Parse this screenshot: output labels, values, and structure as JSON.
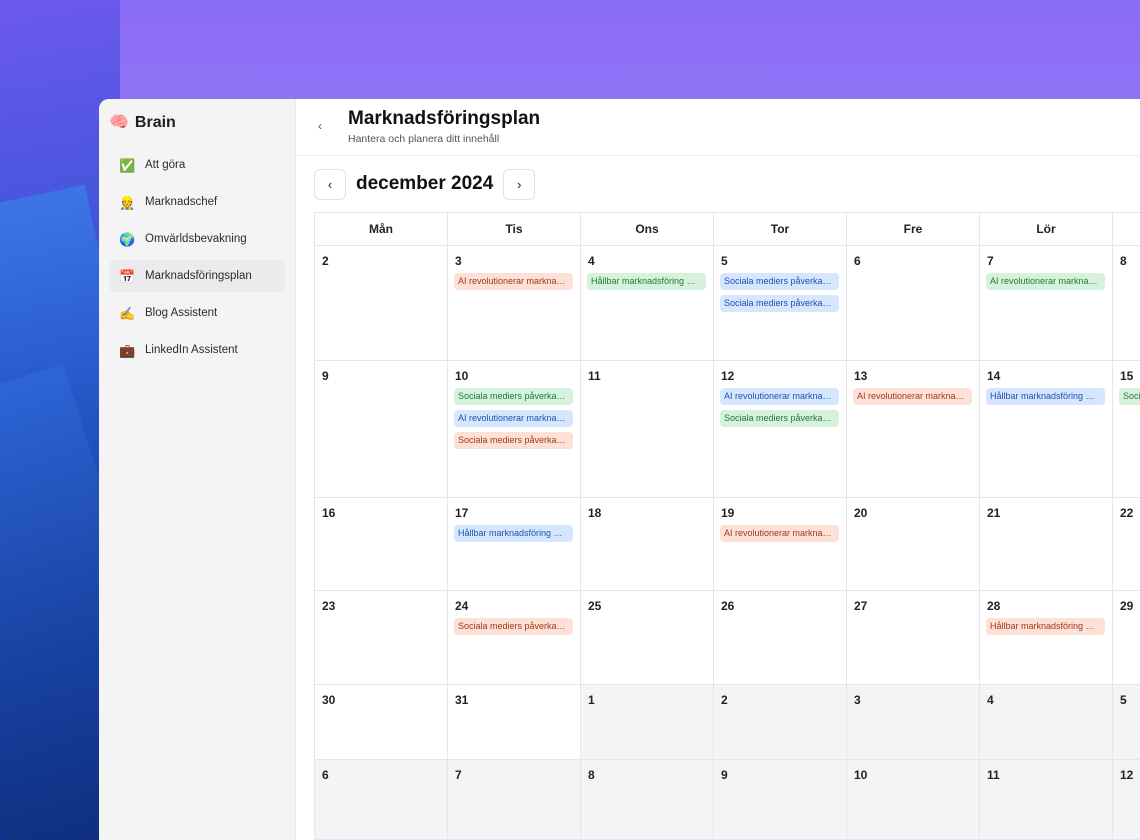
{
  "app": {
    "name": "Brain",
    "icon": "🧠"
  },
  "sidebar": {
    "items": [
      {
        "label": "Att göra",
        "icon": "✅",
        "icon_name": "checkmark-icon",
        "active": false
      },
      {
        "label": "Marknadschef",
        "icon": "👷",
        "icon_name": "worker-icon",
        "active": false
      },
      {
        "label": "Omvärldsbevakning",
        "icon": "🌍",
        "icon_name": "globe-icon",
        "active": false
      },
      {
        "label": "Marknadsföringsplan",
        "icon": "📅",
        "icon_name": "calendar-icon",
        "active": true
      },
      {
        "label": "Blog Assistent",
        "icon": "✍️",
        "icon_name": "writing-hand-icon",
        "active": false
      },
      {
        "label": "LinkedIn Assistent",
        "icon": "💼",
        "icon_name": "briefcase-icon",
        "active": false
      }
    ]
  },
  "header": {
    "back": "‹",
    "title": "Marknadsföringsplan",
    "subtitle": "Hantera och planera ditt innehåll"
  },
  "month_nav": {
    "prev": "‹",
    "next": "›",
    "label": "december 2024"
  },
  "colors": {
    "red_bg": "#fde0d6",
    "green_bg": "#d7f2dc",
    "blue_bg": "#d6e6fd"
  },
  "calendar": {
    "weekdays": [
      "Mån",
      "Tis",
      "Ons",
      "Tor",
      "Fre",
      "Lör",
      ""
    ],
    "weeks": [
      {
        "days": [
          {
            "day": "2",
            "events": []
          },
          {
            "day": "3",
            "events": [
              {
                "text": "AI revolutionerar markna…",
                "color": "red"
              }
            ]
          },
          {
            "day": "4",
            "events": [
              {
                "text": "Hållbar marknadsföring …",
                "color": "green"
              }
            ]
          },
          {
            "day": "5",
            "events": [
              {
                "text": "Sociala mediers påverka…",
                "color": "blue"
              },
              {
                "text": "Sociala mediers påverka…",
                "color": "blue"
              }
            ]
          },
          {
            "day": "6",
            "events": []
          },
          {
            "day": "7",
            "events": [
              {
                "text": "AI revolutionerar markna…",
                "color": "green"
              }
            ]
          },
          {
            "day": "8",
            "events": []
          }
        ]
      },
      {
        "days": [
          {
            "day": "9",
            "events": []
          },
          {
            "day": "10",
            "events": [
              {
                "text": "Sociala mediers påverka…",
                "color": "green"
              },
              {
                "text": "AI revolutionerar markna…",
                "color": "blue"
              },
              {
                "text": "Sociala mediers påverka…",
                "color": "red"
              }
            ]
          },
          {
            "day": "11",
            "events": []
          },
          {
            "day": "12",
            "events": [
              {
                "text": "AI revolutionerar markna…",
                "color": "blue"
              },
              {
                "text": "Sociala mediers påverka…",
                "color": "green"
              }
            ]
          },
          {
            "day": "13",
            "events": [
              {
                "text": "AI revolutionerar markna…",
                "color": "red"
              }
            ]
          },
          {
            "day": "14",
            "events": [
              {
                "text": "Hållbar marknadsföring …",
                "color": "blue"
              }
            ]
          },
          {
            "day": "15",
            "events": [
              {
                "text": "Sociala mediers påverka…",
                "color": "green"
              }
            ]
          }
        ]
      },
      {
        "days": [
          {
            "day": "16",
            "events": []
          },
          {
            "day": "17",
            "events": [
              {
                "text": "Hållbar marknadsföring …",
                "color": "blue"
              }
            ]
          },
          {
            "day": "18",
            "events": []
          },
          {
            "day": "19",
            "events": [
              {
                "text": "AI revolutionerar markna…",
                "color": "red"
              }
            ]
          },
          {
            "day": "20",
            "events": []
          },
          {
            "day": "21",
            "events": []
          },
          {
            "day": "22",
            "events": []
          }
        ]
      },
      {
        "days": [
          {
            "day": "23",
            "events": []
          },
          {
            "day": "24",
            "events": [
              {
                "text": "Sociala mediers påverka…",
                "color": "red"
              }
            ]
          },
          {
            "day": "25",
            "events": []
          },
          {
            "day": "26",
            "events": []
          },
          {
            "day": "27",
            "events": []
          },
          {
            "day": "28",
            "events": [
              {
                "text": "Hållbar marknadsföring …",
                "color": "red"
              }
            ]
          },
          {
            "day": "29",
            "events": []
          }
        ]
      },
      {
        "days": [
          {
            "day": "30",
            "events": []
          },
          {
            "day": "31",
            "events": []
          },
          {
            "day": "1",
            "other": true,
            "events": []
          },
          {
            "day": "2",
            "other": true,
            "events": []
          },
          {
            "day": "3",
            "other": true,
            "events": []
          },
          {
            "day": "4",
            "other": true,
            "events": []
          },
          {
            "day": "5",
            "other": true,
            "events": []
          }
        ]
      },
      {
        "days": [
          {
            "day": "6",
            "other": true,
            "events": []
          },
          {
            "day": "7",
            "other": true,
            "events": []
          },
          {
            "day": "8",
            "other": true,
            "events": []
          },
          {
            "day": "9",
            "other": true,
            "events": []
          },
          {
            "day": "10",
            "other": true,
            "events": []
          },
          {
            "day": "11",
            "other": true,
            "events": []
          },
          {
            "day": "12",
            "other": true,
            "events": []
          }
        ]
      }
    ]
  }
}
